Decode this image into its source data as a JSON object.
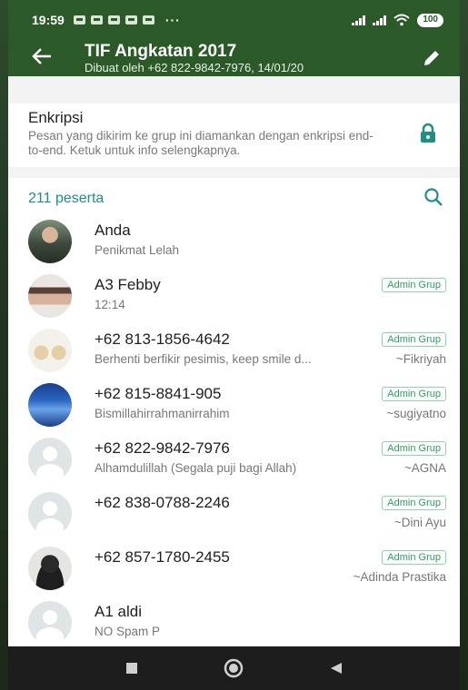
{
  "status_bar": {
    "time": "19:59",
    "notif_dots": "···",
    "battery": "100"
  },
  "header": {
    "title": "TIF Angkatan 2017",
    "subtitle": "Dibuat oleh +62 822-9842-7976, 14/01/20"
  },
  "encryption": {
    "title": "Enkripsi",
    "description": "Pesan yang dikirim ke grup ini diamankan dengan enkripsi end-to-end. Ketuk untuk info selengkapnya."
  },
  "participants": {
    "count_label": "211 peserta",
    "items": [
      {
        "name": "Anda",
        "status": "Penikmat Lelah",
        "badge": "",
        "pushname": ""
      },
      {
        "name": "A3 Febby",
        "status": "12:14",
        "badge": "Admin Grup",
        "pushname": ""
      },
      {
        "name": "+62 813-1856-4642",
        "status": "Berhenti berfikir pesimis, keep smile d...",
        "badge": "Admin Grup",
        "pushname": "~Fikriyah"
      },
      {
        "name": "+62 815-8841-905",
        "status": "Bismillahirrahmanirrahim",
        "badge": "Admin Grup",
        "pushname": "~sugiyatno"
      },
      {
        "name": "+62 822-9842-7976",
        "status": "Alhamdulillah (Segala puji bagi Allah)",
        "badge": "Admin Grup",
        "pushname": "~AGNA"
      },
      {
        "name": "+62 838-0788-2246",
        "status": "",
        "badge": "Admin Grup",
        "pushname": "~Dini Ayu"
      },
      {
        "name": "+62 857-1780-2455",
        "status": "",
        "badge": "Admin Grup",
        "pushname": "~Adinda Prastika"
      },
      {
        "name": "A1 aldi",
        "status": "NO Spam P",
        "badge": "",
        "pushname": ""
      }
    ]
  },
  "colors": {
    "header": "#2b5a28",
    "accent": "#1e8f86",
    "badge": "#2aa05a"
  }
}
